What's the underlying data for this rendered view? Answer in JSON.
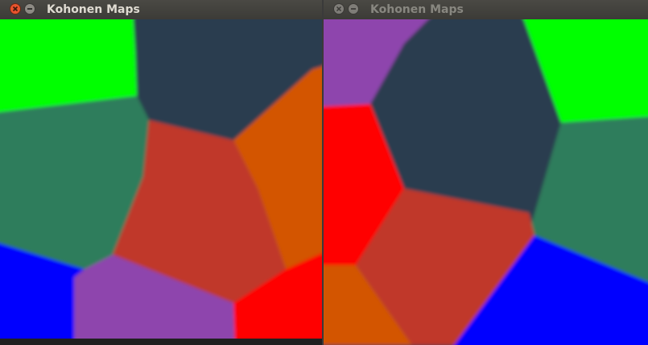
{
  "windows": [
    {
      "title": "Kohonen Maps",
      "focused": true,
      "colors": {
        "green": "#00ff00",
        "dark_slate": "#2c3e50",
        "sea_green": "#2e7d5b",
        "orange": "#d35400",
        "brick": "#c0392b",
        "blue": "#0000ff",
        "purple": "#8e44ad",
        "red": "#ff0000"
      }
    },
    {
      "title": "Kohonen Maps",
      "focused": false,
      "colors": {
        "purple": "#8e44ad",
        "dark_slate": "#2c3e50",
        "green": "#00ff00",
        "red": "#ff0000",
        "sea_green": "#2e7d5b",
        "brick": "#c0392b",
        "orange": "#d35400",
        "blue": "#0000ff"
      }
    }
  ],
  "icons": {
    "close": "close-icon",
    "minimize": "minimize-icon"
  }
}
